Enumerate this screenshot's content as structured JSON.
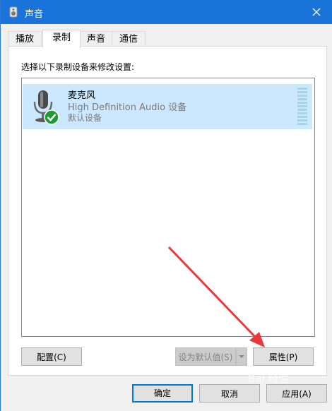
{
  "window": {
    "title": "声音",
    "close_icon": "close-icon",
    "app_icon": "speaker-icon"
  },
  "tabs": [
    {
      "label": "播放",
      "active": false
    },
    {
      "label": "录制",
      "active": true
    },
    {
      "label": "声音",
      "active": false
    },
    {
      "label": "通信",
      "active": false
    }
  ],
  "panel": {
    "instruction": "选择以下录制设备来修改设置:"
  },
  "devices": [
    {
      "name": "麦克风",
      "description": "High Definition Audio 设备",
      "status": "默认设备",
      "icon": "microphone-icon",
      "badge_icon": "check-icon",
      "selected": true
    }
  ],
  "panel_buttons": {
    "configure": "配置(C)",
    "set_default": "设为默认值(S)",
    "properties": "属性(P)"
  },
  "dialog_buttons": {
    "ok": "确定",
    "cancel": "取消",
    "apply": "应用(A)"
  },
  "watermark": "Bai 经验",
  "colors": {
    "titlebar": "#1a73d9",
    "selection": "#cce8ff",
    "accent": "#0078d7",
    "annotation_arrow": "#e8383a"
  }
}
